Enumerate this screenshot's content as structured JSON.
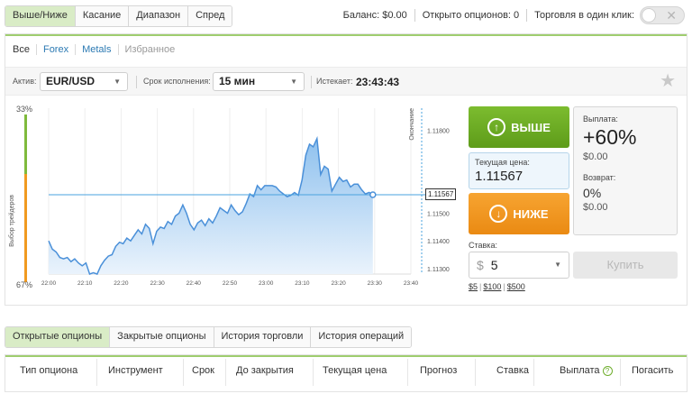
{
  "top_tabs": [
    "Выше/Ниже",
    "Касание",
    "Диапазон",
    "Спред"
  ],
  "balance": "Баланс: $0.00",
  "open_options": "Открыто опционов: 0",
  "one_click": "Торговля в один клик:",
  "filter_tabs": [
    "Все",
    "Forex",
    "Metals",
    "Избранное"
  ],
  "params": {
    "asset_label": "Актив:",
    "asset_value": "EUR/USD",
    "term_label": "Срок исполнения:",
    "term_value": "15 мин",
    "expires_label": "Истекает:",
    "expires_value": "23:43:43"
  },
  "chart": {
    "top_pct": "33%",
    "bottom_pct": "67%",
    "trader_choice_label": "Выбор трейдеров",
    "expiry_label": "Окончание",
    "current_price_tag": "1.11567",
    "colors": {
      "line": "#4a90d9",
      "fill_top": "#8fc1ee",
      "fill_bottom": "#eaf3fc",
      "guide": "#4aa3df"
    }
  },
  "chart_data": {
    "type": "area",
    "x_ticks": [
      "22:00",
      "22:10",
      "22:20",
      "22:30",
      "22:40",
      "22:50",
      "23:00",
      "23:10",
      "23:20",
      "23:30",
      "23:40"
    ],
    "y_ticks": [
      1.118,
      1.115,
      1.114,
      1.113
    ],
    "y_tick_labels": [
      "1.11800",
      "1.11500",
      "1.11400",
      "1.11300"
    ],
    "ylim": [
      1.1128,
      1.1188
    ],
    "current": 1.11567,
    "series": [
      {
        "values": [
          1.114,
          1.1137,
          1.1136,
          1.1134,
          1.11335,
          1.1134,
          1.11325,
          1.11335,
          1.1132,
          1.1131,
          1.1132,
          1.1128,
          1.11285,
          1.1128,
          1.1131,
          1.1133,
          1.11345,
          1.1135,
          1.1138,
          1.11395,
          1.1139,
          1.1141,
          1.114,
          1.1142,
          1.1144,
          1.11425,
          1.1146,
          1.11445,
          1.1139,
          1.11435,
          1.1145,
          1.11445,
          1.1147,
          1.1146,
          1.1149,
          1.115,
          1.1153,
          1.115,
          1.1146,
          1.1144,
          1.11465,
          1.11475,
          1.11455,
          1.1148,
          1.11465,
          1.1149,
          1.1152,
          1.1151,
          1.115,
          1.1153,
          1.1151,
          1.11495,
          1.11505,
          1.11535,
          1.1157,
          1.1156,
          1.116,
          1.11585,
          1.116,
          1.116,
          1.116,
          1.11595,
          1.1158,
          1.1157,
          1.1156,
          1.11565,
          1.11575,
          1.11565,
          1.1162,
          1.1171,
          1.1175,
          1.1174,
          1.1177,
          1.1164,
          1.1167,
          1.1166,
          1.1158,
          1.11605,
          1.1163,
          1.11615,
          1.1162,
          1.11595,
          1.11605,
          1.11605,
          1.11585,
          1.1157,
          1.11575,
          1.11567
        ]
      }
    ]
  },
  "controls": {
    "up_label": "ВЫШЕ",
    "down_label": "НИЖЕ",
    "current_price_label": "Текущая цена:",
    "current_price_value": "1.11567",
    "payout_label": "Выплата:",
    "payout_value": "+60%",
    "payout_amount": "$0.00",
    "refund_label": "Возврат:",
    "refund_value": "0%",
    "refund_amount": "$0.00",
    "stake_label": "Ставка:",
    "stake_currency": "$",
    "stake_value": "5",
    "quick_amounts": [
      "$5",
      "$100",
      "$500"
    ],
    "buy_label": "Купить"
  },
  "bottom_tabs": [
    "Открытые опционы",
    "Закрытые опционы",
    "История торговли",
    "История операций"
  ],
  "table_headers": [
    "Тип опциона",
    "Инструмент",
    "Срок",
    "До закрытия",
    "Текущая цена",
    "Прогноз",
    "Ставка",
    "Выплата",
    "Погасить"
  ]
}
